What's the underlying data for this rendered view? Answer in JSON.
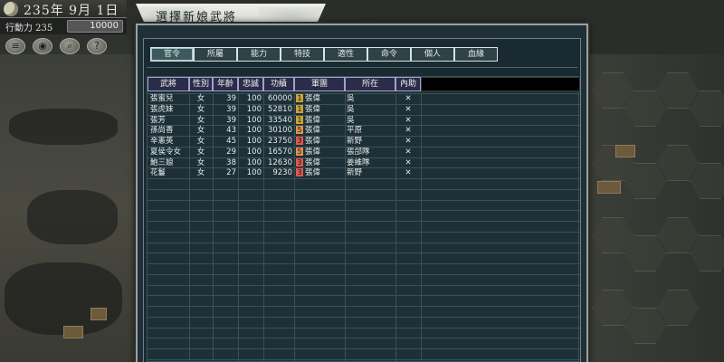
{
  "hud": {
    "date": "235年 9月 1日",
    "action_points": "行動力 235",
    "gold": "10000"
  },
  "dialog": {
    "title": "選擇新娘武將",
    "tabs": [
      "官令",
      "所屬",
      "能力",
      "特技",
      "適性",
      "命令",
      "個人",
      "血緣"
    ],
    "active_tab": 0
  },
  "table": {
    "columns": [
      "武將",
      "性別",
      "年齡",
      "忠誠",
      "功績",
      "軍團",
      "所在",
      "內助"
    ],
    "rows": [
      {
        "name": "張蜜兒",
        "sex": "女",
        "age": "39",
        "loyalty": "100",
        "merit": "60000",
        "legion_no": "1",
        "legion_color": "#c9a33a",
        "legion": "張偉",
        "location": "吳",
        "aid": "✕"
      },
      {
        "name": "張虎妹",
        "sex": "女",
        "age": "39",
        "loyalty": "100",
        "merit": "52810",
        "legion_no": "1",
        "legion_color": "#c9a33a",
        "legion": "張偉",
        "location": "吳",
        "aid": "✕"
      },
      {
        "name": "張芳",
        "sex": "女",
        "age": "39",
        "loyalty": "100",
        "merit": "33540",
        "legion_no": "1",
        "legion_color": "#c9a33a",
        "legion": "張偉",
        "location": "吳",
        "aid": "✕"
      },
      {
        "name": "孫尚香",
        "sex": "女",
        "age": "43",
        "loyalty": "100",
        "merit": "30100",
        "legion_no": "5",
        "legion_color": "#e0904a",
        "legion": "張偉",
        "location": "平原",
        "aid": "✕"
      },
      {
        "name": "辛憲英",
        "sex": "女",
        "age": "45",
        "loyalty": "100",
        "merit": "23750",
        "legion_no": "3",
        "legion_color": "#e0584a",
        "legion": "張偉",
        "location": "新野",
        "aid": "✕"
      },
      {
        "name": "夏侯令女",
        "sex": "女",
        "age": "29",
        "loyalty": "100",
        "merit": "16570",
        "legion_no": "5",
        "legion_color": "#e0904a",
        "legion": "張偉",
        "location": "張郃隊",
        "aid": "✕"
      },
      {
        "name": "鮑三娘",
        "sex": "女",
        "age": "38",
        "loyalty": "100",
        "merit": "12630",
        "legion_no": "3",
        "legion_color": "#e0584a",
        "legion": "張偉",
        "location": "姜維隊",
        "aid": "✕"
      },
      {
        "name": "花鬘",
        "sex": "女",
        "age": "27",
        "loyalty": "100",
        "merit": "9230",
        "legion_no": "3",
        "legion_color": "#e0584a",
        "legion": "張偉",
        "location": "新野",
        "aid": "✕"
      }
    ]
  }
}
